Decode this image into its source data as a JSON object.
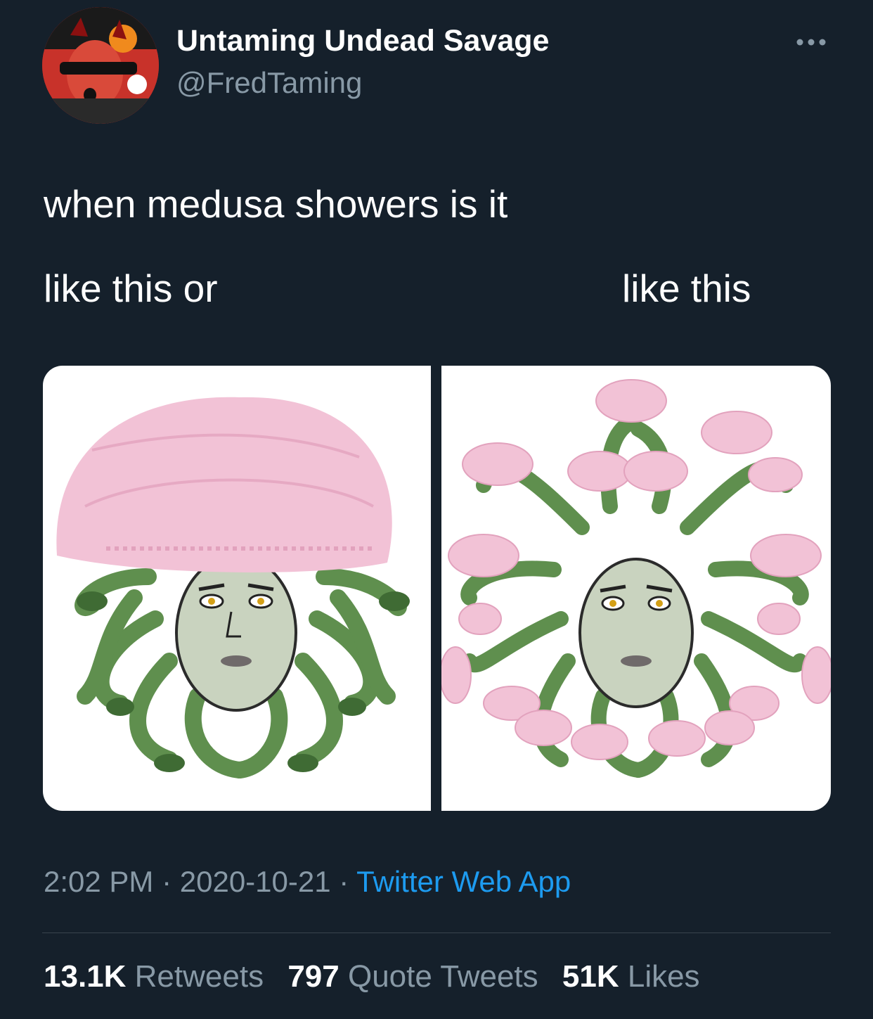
{
  "tweet": {
    "author": {
      "display_name": "Untaming Undead Savage",
      "handle": "@FredTaming"
    },
    "text_line1": "when medusa showers is it",
    "caption_left": "like this or",
    "caption_right": "like this",
    "time": "2:02 PM",
    "separator": " · ",
    "date": "2020-10-21",
    "source": "Twitter Web App",
    "stats": {
      "retweets_count": "13.1K",
      "retweets_label": "Retweets",
      "quote_count": "797",
      "quote_label": "Quote Tweets",
      "likes_count": "51K",
      "likes_label": "Likes"
    }
  },
  "colors": {
    "background": "#15202b",
    "muted": "#8899a6",
    "link": "#1d9bf0",
    "snake": "#5f8f4e",
    "cap": "#f2c2d6"
  },
  "icons": [
    "more-icon",
    "avatar"
  ]
}
